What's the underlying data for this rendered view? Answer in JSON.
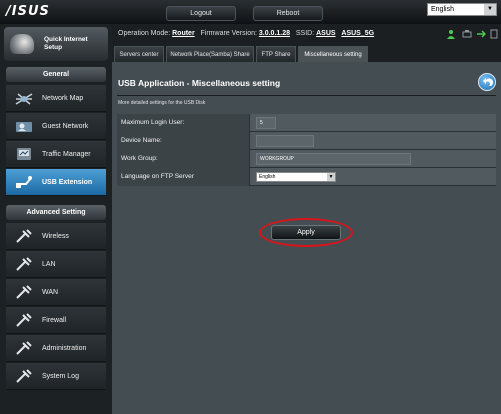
{
  "brand": {
    "logo": "/ISUS"
  },
  "topbar": {
    "logout": "Logout",
    "reboot": "Reboot",
    "language": "English"
  },
  "sidebar": {
    "quick_setup": "Quick Internet Setup",
    "general_header": "General",
    "general_items": [
      {
        "label": "Network Map",
        "icon": "network-map-icon"
      },
      {
        "label": "Guest Network",
        "icon": "guest-network-icon"
      },
      {
        "label": "Traffic Manager",
        "icon": "traffic-manager-icon"
      },
      {
        "label": "USB Extension",
        "icon": "usb-extension-icon",
        "active": true
      }
    ],
    "advanced_header": "Advanced Setting",
    "advanced_items": [
      {
        "label": "Wireless",
        "icon": "wrench-icon"
      },
      {
        "label": "LAN",
        "icon": "wrench-icon"
      },
      {
        "label": "WAN",
        "icon": "wrench-icon"
      },
      {
        "label": "Firewall",
        "icon": "wrench-icon"
      },
      {
        "label": "Administration",
        "icon": "wrench-icon"
      },
      {
        "label": "System Log",
        "icon": "wrench-icon"
      }
    ]
  },
  "status": {
    "mode_label": "Operation Mode:",
    "mode_value": "Router",
    "fw_label": "Firmware Version:",
    "fw_value": "3.0.0.1.28",
    "ssid_label": "SSID:",
    "ssid_1": "ASUS",
    "ssid_2": "ASUS_5G"
  },
  "tabs": [
    {
      "label": "Servers center"
    },
    {
      "label": "Network Place(Samba) Share"
    },
    {
      "label": "FTP Share"
    },
    {
      "label": "Miscellaneous setting",
      "active": true
    }
  ],
  "panel": {
    "title": "USB Application - Miscellaneous setting",
    "description": "More detailed settings for the USB Disk"
  },
  "form": {
    "max_login_label": "Maximum Login User:",
    "max_login_value": "5",
    "device_name_label": "Device Name:",
    "device_name_value": "",
    "workgroup_label": "Work Group:",
    "workgroup_value": "WORKGROUP",
    "ftp_lang_label": "Language on FTP Server",
    "ftp_lang_value": "English"
  },
  "apply": "Apply",
  "colors": {
    "active_nav": "#1c6aa4",
    "highlight_ring": "#d8141b",
    "panel_bg": "#444d52"
  }
}
